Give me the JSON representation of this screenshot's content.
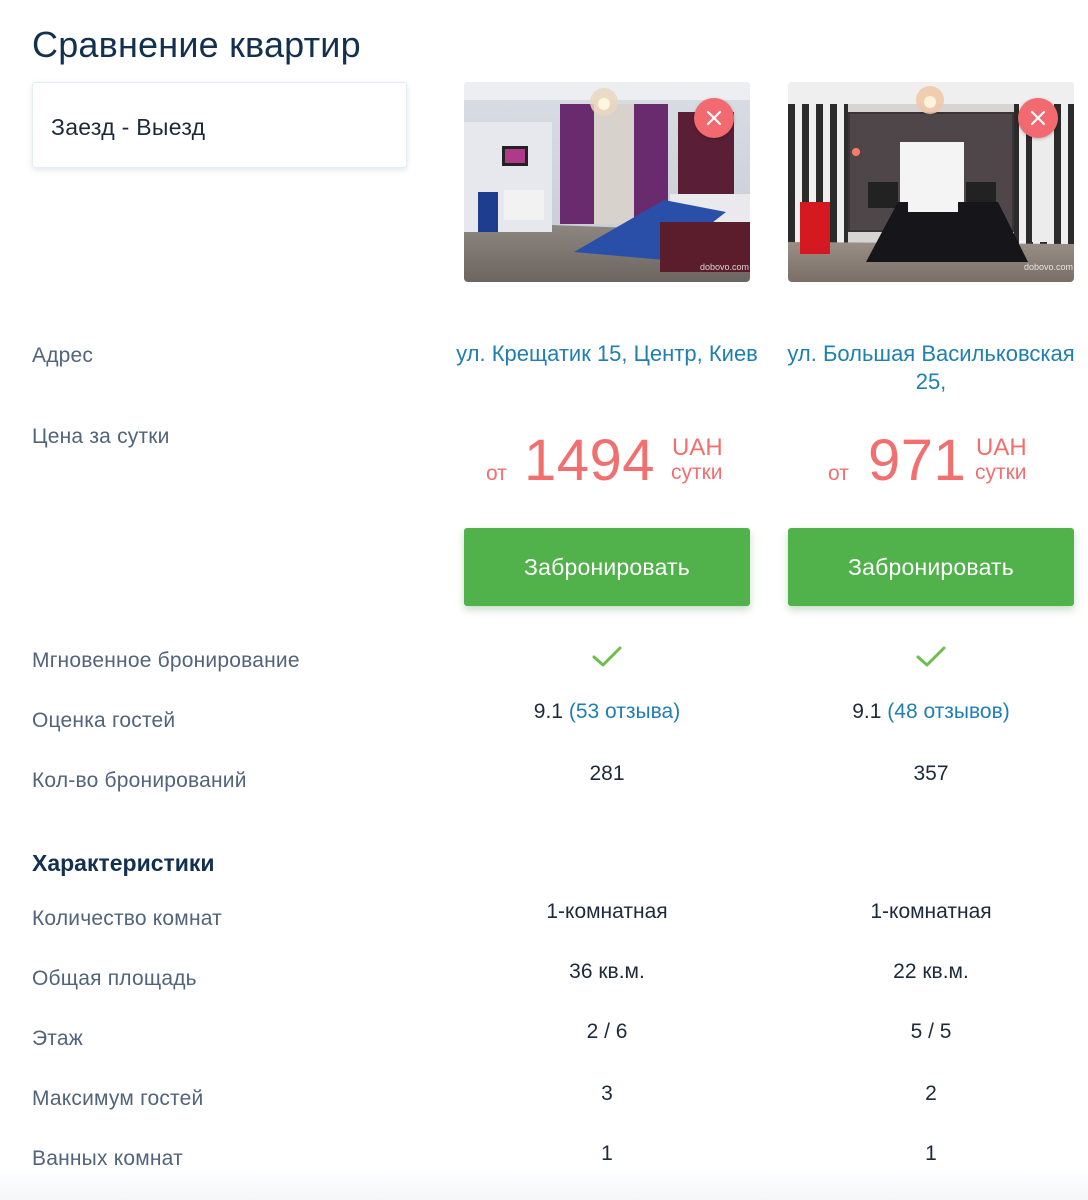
{
  "page": {
    "title": "Сравнение квартир"
  },
  "dates": {
    "label": "Заезд - Выезд"
  },
  "labels": {
    "address": "Адрес",
    "price": "Цена за сутки",
    "instant": "Мгновенное бронирование",
    "rating": "Оценка гостей",
    "bookings": "Кол-во бронирований",
    "characteristics": "Характеристики",
    "rooms": "Количество комнат",
    "area": "Общая площадь",
    "floor": "Этаж",
    "guests": "Максимум гостей",
    "bathrooms": "Ванных комнат"
  },
  "apartments": [
    {
      "address": "ул. Крещатик 15, Центр, Киев",
      "price_prefix": "от",
      "price": "1494",
      "currency": "UAH",
      "price_unit": "сутки",
      "book_label": "Забронировать",
      "instant_booking": true,
      "rating_score": "9.1",
      "rating_reviews": "(53 отзыва)",
      "bookings": "281",
      "rooms": "1-комнатная",
      "area": "36 кв.м.",
      "floor": "2 / 6",
      "max_guests": "3",
      "bathrooms": "1",
      "photo_watermark": "dobovo.com"
    },
    {
      "address": "ул. Большая Васильковская 25,",
      "price_prefix": "от",
      "price": "971",
      "currency": "UAH",
      "price_unit": "сутки",
      "book_label": "Забронировать",
      "instant_booking": true,
      "rating_score": "9.1",
      "rating_reviews": "(48 отзывов)",
      "bookings": "357",
      "rooms": "1-комнатная",
      "area": "22 кв.м.",
      "floor": "5 / 5",
      "max_guests": "2",
      "bathrooms": "1",
      "photo_watermark": "dobovo.com"
    }
  ],
  "icons": {
    "remove": "close-icon",
    "instant": "checkmark-icon"
  },
  "colors": {
    "title": "#13314f",
    "link": "#1f7fb0",
    "price": "#f1706f",
    "book_button": "#51b14a",
    "remove_button": "#f26a6f",
    "check": "#6cbf4e",
    "label": "#51647a"
  }
}
